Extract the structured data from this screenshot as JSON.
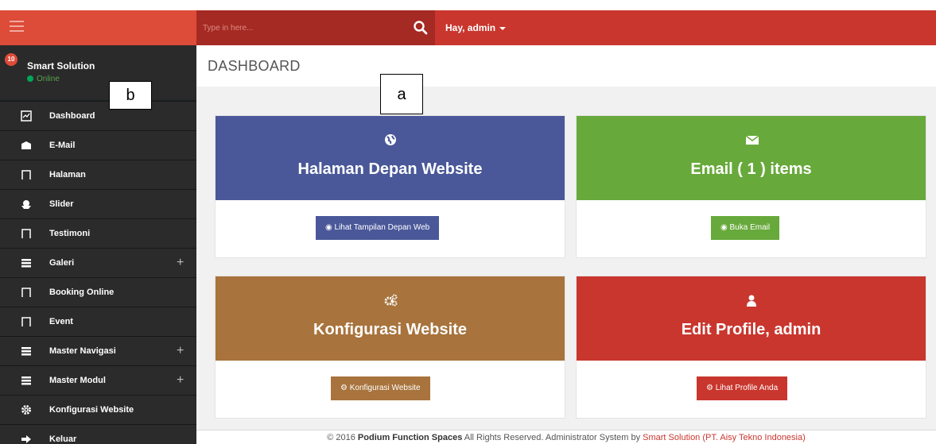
{
  "topbar": {
    "search_placeholder": "Type in here...",
    "user_greeting": "Hay, admin"
  },
  "sidebar": {
    "notification_count": "10",
    "brand": "Smart Solution",
    "status": "Online",
    "items": [
      {
        "label": "Dashboard"
      },
      {
        "label": "E-Mail"
      },
      {
        "label": "Halaman"
      },
      {
        "label": "Slider"
      },
      {
        "label": "Testimoni"
      },
      {
        "label": "Galeri",
        "expand": "+"
      },
      {
        "label": "Booking Online"
      },
      {
        "label": "Event"
      },
      {
        "label": "Master Navigasi",
        "expand": "+"
      },
      {
        "label": "Master Modul",
        "expand": "+"
      },
      {
        "label": "Konfigurasi Website"
      },
      {
        "label": "Keluar"
      }
    ]
  },
  "main": {
    "page_title": "DASHBOARD",
    "cards": [
      {
        "title": "Halaman Depan Website",
        "button": "Lihat Tampilan Depan Web",
        "color": "#4a5899"
      },
      {
        "title": "Email ( 1 ) items",
        "button": "Buka Email",
        "color": "#68a93b"
      },
      {
        "title": "Konfigurasi Website",
        "button": "Konfigurasi Website",
        "color": "#a8733c"
      },
      {
        "title": "Edit Profile, admin",
        "button": "Lihat Profile Anda",
        "color": "#c9362e"
      }
    ],
    "footer": {
      "prefix": "© 2016",
      "company": "Podium Function Spaces",
      "middle": "All Rights Reserved. Administrator System by",
      "vendor": "Smart Solution (PT. Aisy Tekno Indonesia)"
    }
  },
  "annotations": {
    "label_a": "a",
    "label_b": "b"
  }
}
